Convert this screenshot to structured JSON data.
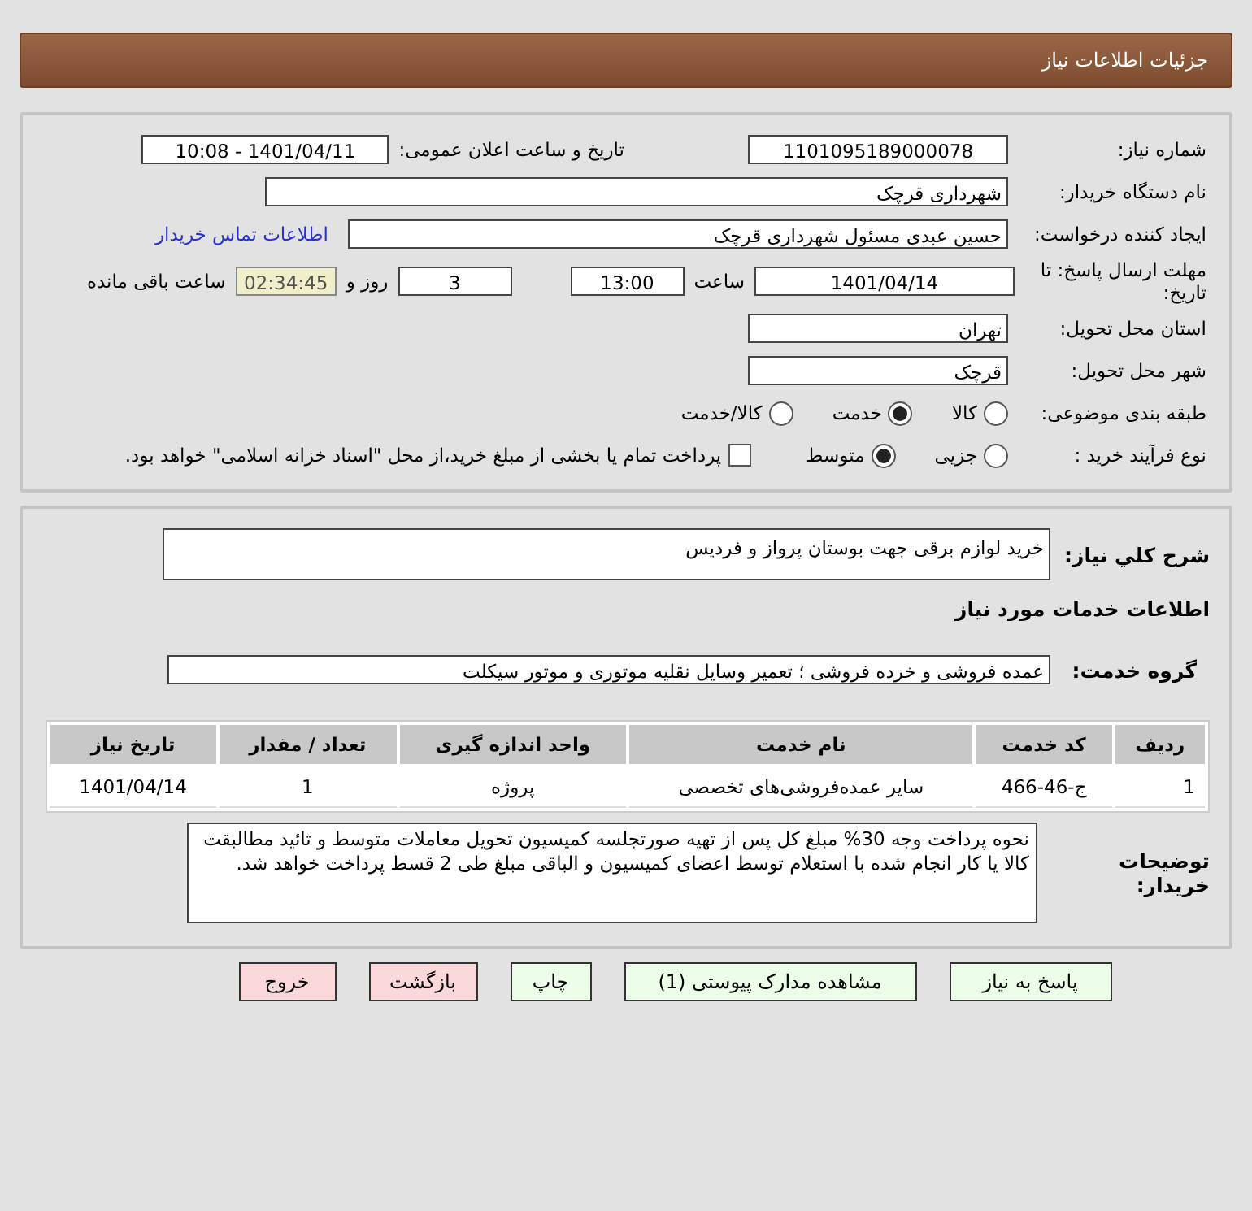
{
  "header": {
    "title": "جزئیات اطلاعات نیاز"
  },
  "details": {
    "need_number": {
      "label": "شماره نیاز:",
      "value": "1101095189000078"
    },
    "announce": {
      "label": "تاریخ و ساعت اعلان عمومی:",
      "value": "1401/04/11 - 10:08"
    },
    "buyer_org": {
      "label": "نام دستگاه خریدار:",
      "value": "شهرداری قرچک"
    },
    "requester": {
      "label": "ایجاد کننده درخواست:",
      "value": "حسین عبدی مسئول شهرداری قرچک",
      "link": "اطلاعات تماس خریدار"
    },
    "deadline": {
      "label": "مهلت ارسال پاسخ: تا تاریخ:",
      "date": "1401/04/14",
      "time_label": "ساعت",
      "time": "13:00",
      "days": "3",
      "days_label": "روز و",
      "remaining": "02:34:45",
      "remaining_label": "ساعت باقی مانده"
    },
    "province": {
      "label": "استان محل تحویل:",
      "value": "تهران"
    },
    "city": {
      "label": "شهر محل تحویل:",
      "value": "قرچک"
    },
    "category": {
      "label": "طبقه بندی موضوعی:",
      "options": [
        {
          "label": "کالا",
          "selected": false
        },
        {
          "label": "خدمت",
          "selected": true
        },
        {
          "label": "کالا/خدمت",
          "selected": false
        }
      ]
    },
    "process": {
      "label": "نوع فرآیند خرید :",
      "options": [
        {
          "label": "جزیی",
          "selected": false
        },
        {
          "label": "متوسط",
          "selected": true
        }
      ],
      "checkbox": {
        "label": "پرداخت تمام یا بخشی از مبلغ خرید،از محل \"اسناد خزانه اسلامی\" خواهد بود.",
        "checked": false
      }
    }
  },
  "services": {
    "description": {
      "label": "شرح کلي نياز:",
      "value": "خرید لوازم برقی جهت بوستان پرواز و فردیس"
    },
    "title": "اطلاعات خدمات مورد نیاز",
    "group": {
      "label": "گروه خدمت:",
      "value": "عمده فروشی و خرده فروشی ؛ تعمیر وسایل نقلیه موتوری و موتور سیکلت"
    },
    "table": {
      "columns": [
        "ردیف",
        "کد خدمت",
        "نام خدمت",
        "واحد اندازه گیری",
        "تعداد / مقدار",
        "تاریخ نیاز"
      ],
      "rows": [
        [
          "1",
          "ج-46-466",
          "سایر عمده‌فروشی‌های تخصصی",
          "پروژه",
          "1",
          "1401/04/14"
        ]
      ]
    },
    "notes": {
      "label": "توضیحات خریدار:",
      "value": "نحوه پرداخت وجه 30% مبلغ کل پس از تهیه صورتجلسه کمیسیون تحویل معاملات متوسط و تائید مطالبقت کالا یا کار انجام شده با استعلام توسط اعضای کمیسیون و الباقی مبلغ طی 2 قسط پرداخت خواهد شد."
    }
  },
  "buttons": [
    {
      "label": "پاسخ به نیاز",
      "kind": "normal"
    },
    {
      "label": "مشاهده مدارک پیوستی (1)",
      "kind": "normal"
    },
    {
      "label": "چاپ",
      "kind": "normal"
    },
    {
      "label": "بازگشت",
      "kind": "danger"
    },
    {
      "label": "خروج",
      "kind": "danger"
    }
  ]
}
